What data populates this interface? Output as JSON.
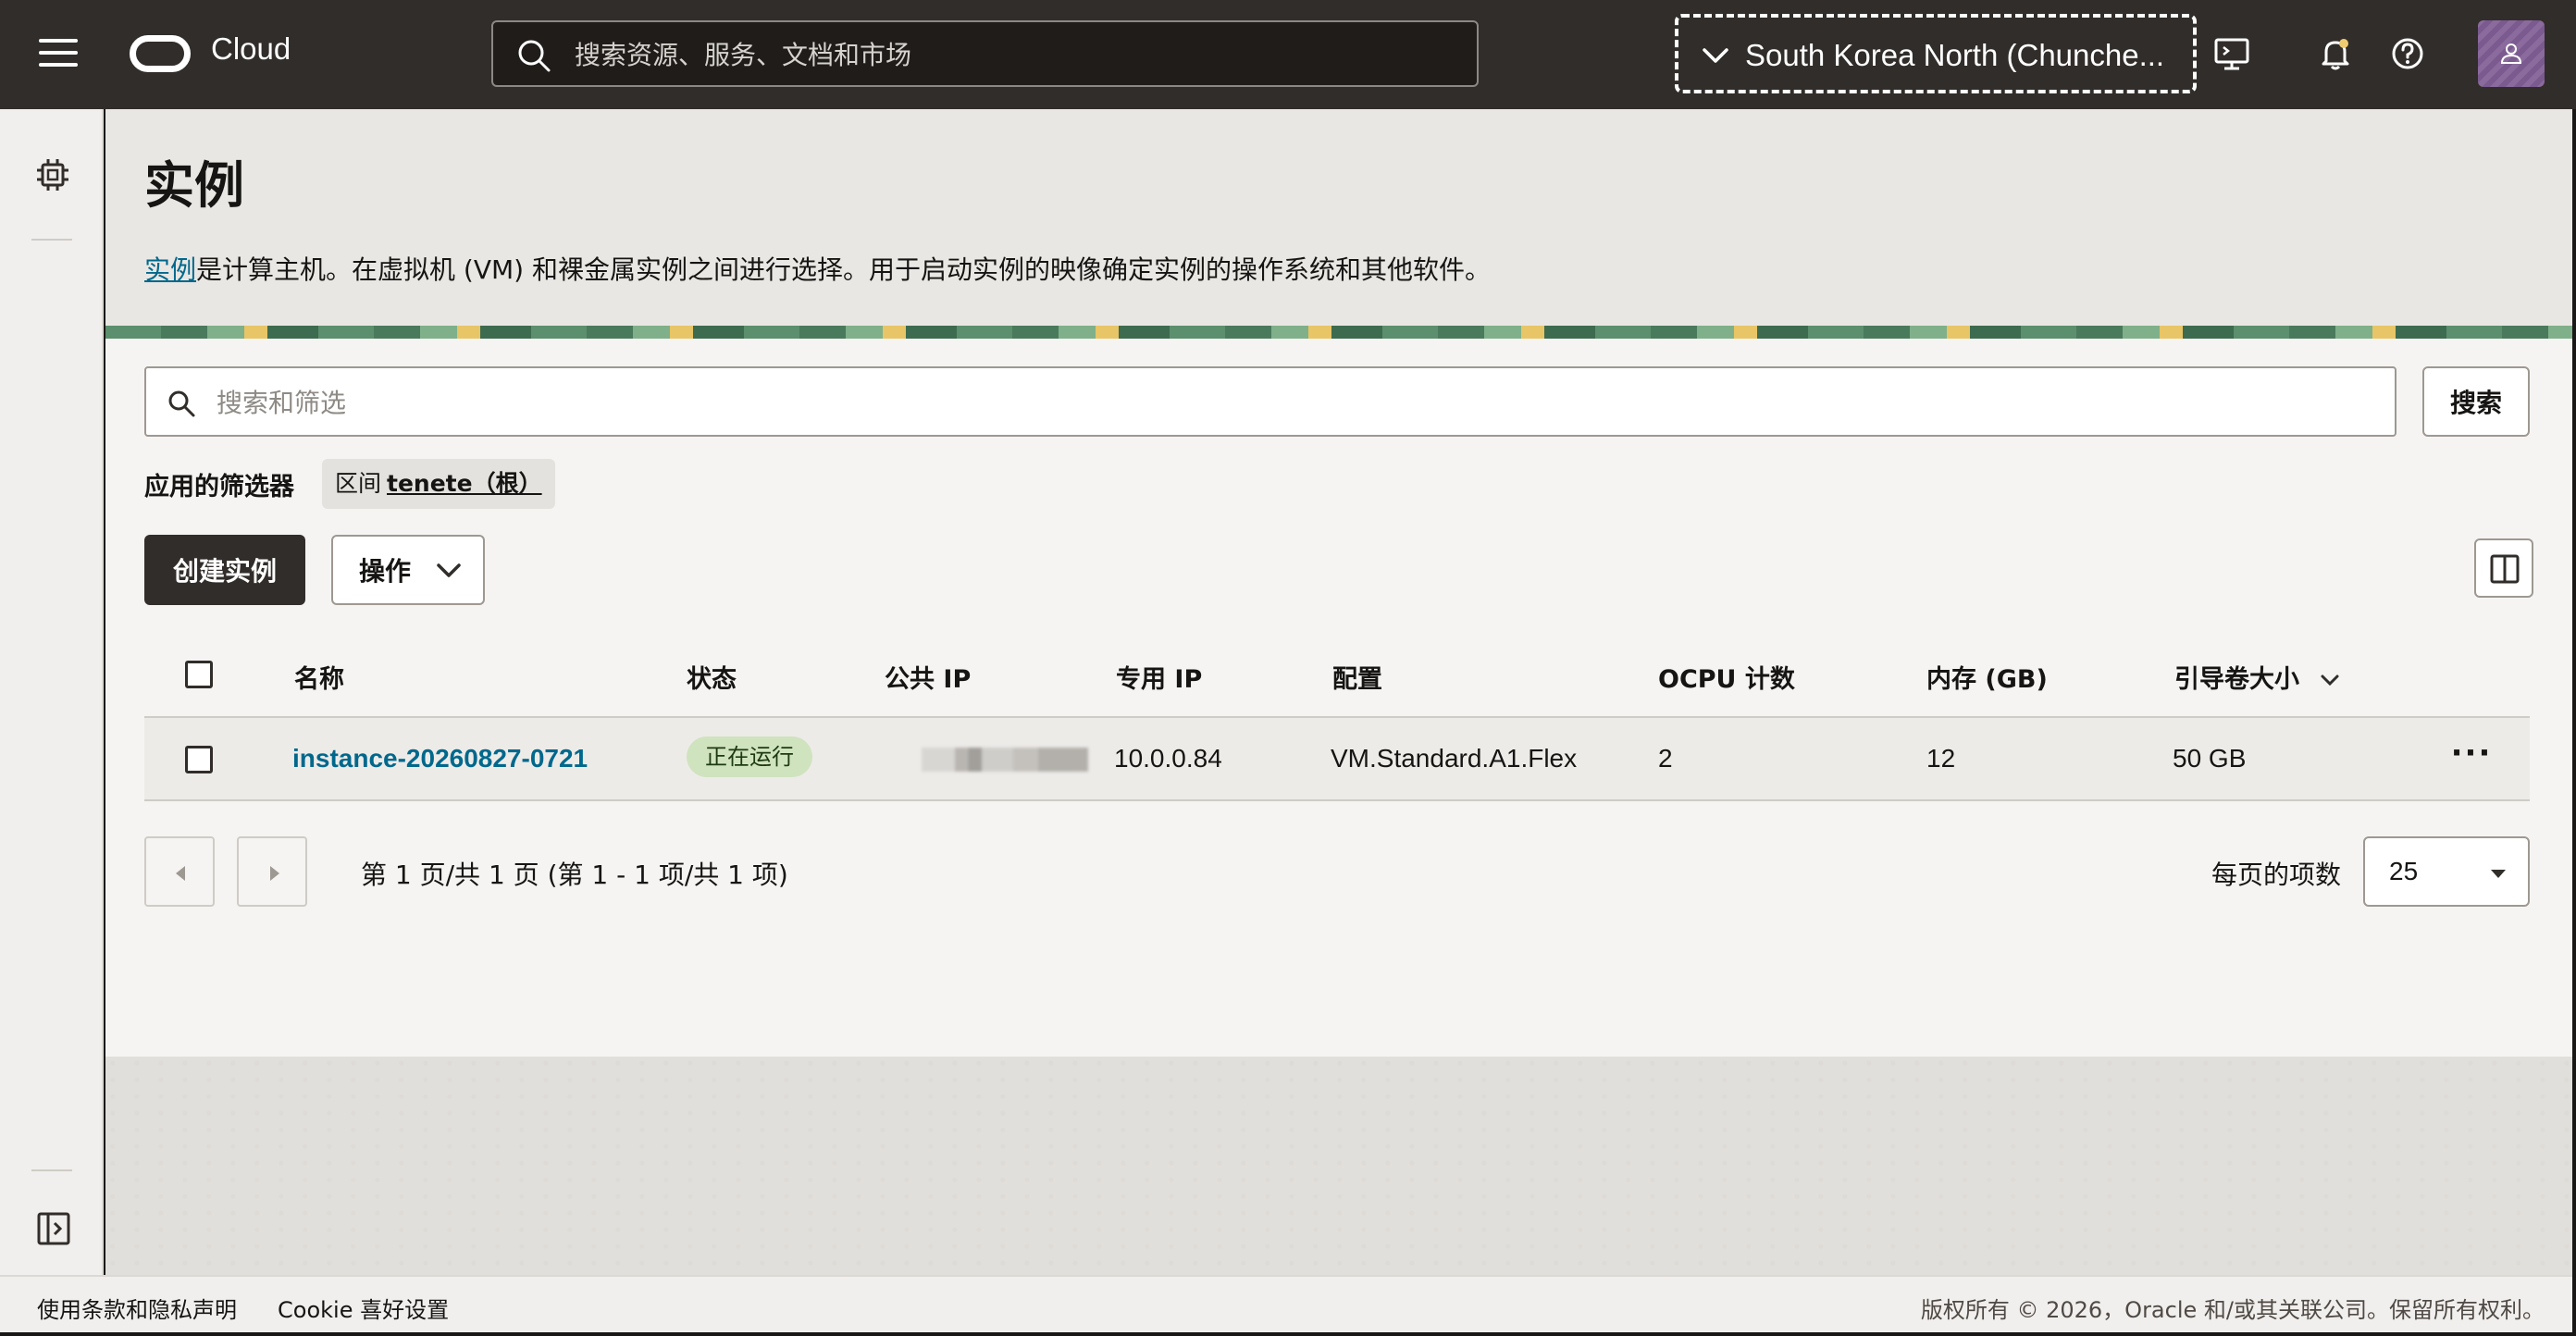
{
  "header": {
    "brand": "Cloud",
    "search_placeholder": "搜索资源、服务、文档和市场",
    "region": "South Korea North (Chunche..."
  },
  "page": {
    "title": "实例",
    "desc_link": "实例",
    "desc_text": "是计算主机。在虚拟机 (VM) 和裸金属实例之间进行选择。用于启动实例的映像确定实例的操作系统和其他软件。"
  },
  "filters": {
    "search_placeholder": "搜索和筛选",
    "search_button": "搜索",
    "applied_label": "应用的筛选器",
    "chip_key": "区间",
    "chip_value": "tenete（根）"
  },
  "toolbar": {
    "create_label": "创建实例",
    "actions_label": "操作"
  },
  "table": {
    "columns": [
      "名称",
      "状态",
      "公共 IP",
      "专用 IP",
      "配置",
      "OCPU 计数",
      "内存 (GB)",
      "引导卷大小"
    ],
    "rows": [
      {
        "name": "instance-20260827-0721",
        "status": "正在运行",
        "public_ip": "",
        "private_ip": "10.0.0.84",
        "shape": "VM.Standard.A1.Flex",
        "ocpu": "2",
        "memory": "12",
        "boot_volume": "50 GB"
      }
    ]
  },
  "pagination": {
    "summary": "第 1 页/共 1 页 (第 1 - 1 项/共 1 项)",
    "per_page_label": "每页的项数",
    "per_page_value": "25"
  },
  "footer": {
    "terms": "使用条款和隐私声明",
    "cookie": "Cookie 喜好设置",
    "copyright": "版权所有 © 2026，Oracle 和/或其关联公司。保留所有权利。"
  },
  "colors": {
    "header_bg": "#312d2a",
    "link": "#00688c",
    "status_running_bg": "#cfe3bf"
  }
}
